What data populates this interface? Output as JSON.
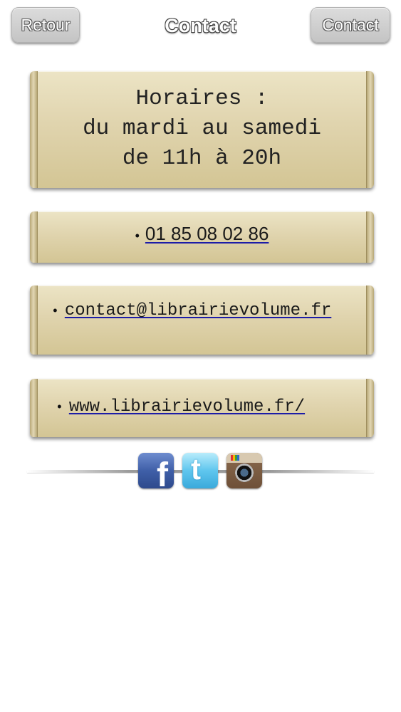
{
  "header": {
    "back_label": "Retour",
    "title": "Contact",
    "contact_label": "Contact"
  },
  "hours": {
    "line1": "Horaires :",
    "line2": "du mardi au samedi",
    "line3": "de 11h à 20h"
  },
  "contacts": {
    "bullet": "•",
    "phone": "01 85 08 02 86",
    "email": "contact@librairievolume.fr",
    "website": "www.librairievolume.fr/"
  },
  "social": {
    "facebook": {
      "icon": "facebook-icon",
      "glyph": "f",
      "color": "#3f5fa8"
    },
    "twitter": {
      "icon": "twitter-icon",
      "glyph": "t",
      "color": "#5fc6ee"
    },
    "instagram": {
      "icon": "instagram-icon",
      "color": "#6e5038"
    }
  },
  "colors": {
    "card": "#e0d4ae",
    "link_underline": "#1c1ca8",
    "header_button": "#cfcfcf"
  }
}
